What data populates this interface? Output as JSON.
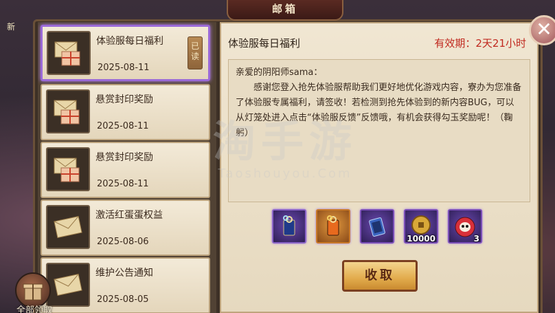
{
  "window": {
    "title": "邮箱"
  },
  "side_tag": "新",
  "mails": [
    {
      "title": "体验服每日福利",
      "date": "2025-08-11",
      "read_label": "已读",
      "selected": true
    },
    {
      "title": "悬赏封印奖励",
      "date": "2025-08-11"
    },
    {
      "title": "悬赏封印奖励",
      "date": "2025-08-11"
    },
    {
      "title": "激活红蛋蛋权益",
      "date": "2025-08-06"
    },
    {
      "title": "维护公告通知",
      "date": "2025-08-05"
    }
  ],
  "claim_all_label": "全部领取",
  "detail": {
    "title": "体验服每日福利",
    "validity": "有效期：2天21小时",
    "greeting": "亲爱的阴阳师sama：",
    "body": "感谢您登入抢先体验服帮助我们更好地优化游戏内容，寮办为您准备了体验服专属福利，请签收！若检测到抢先体验到的新内容BUG，可以从灯笼处进入点击“体验服反馈”反馈哦，有机会获得勾玉奖励呢！（鞠躬）",
    "rewards": [
      {
        "icon": "blue-charm-icon",
        "count": ""
      },
      {
        "icon": "orange-charm-icon",
        "count": ""
      },
      {
        "icon": "blue-ticket-icon",
        "count": ""
      },
      {
        "icon": "gold-coin-icon",
        "count": "10000"
      },
      {
        "icon": "daruma-icon",
        "count": "3"
      }
    ],
    "claim_label": "收取"
  },
  "watermark": {
    "main": "淘手游",
    "sub": "Taoshouyou.Com"
  },
  "colors": {
    "accent_red": "#c0281e",
    "selected_border": "#9b6ad8",
    "button_gold": "#e2ab4c"
  }
}
